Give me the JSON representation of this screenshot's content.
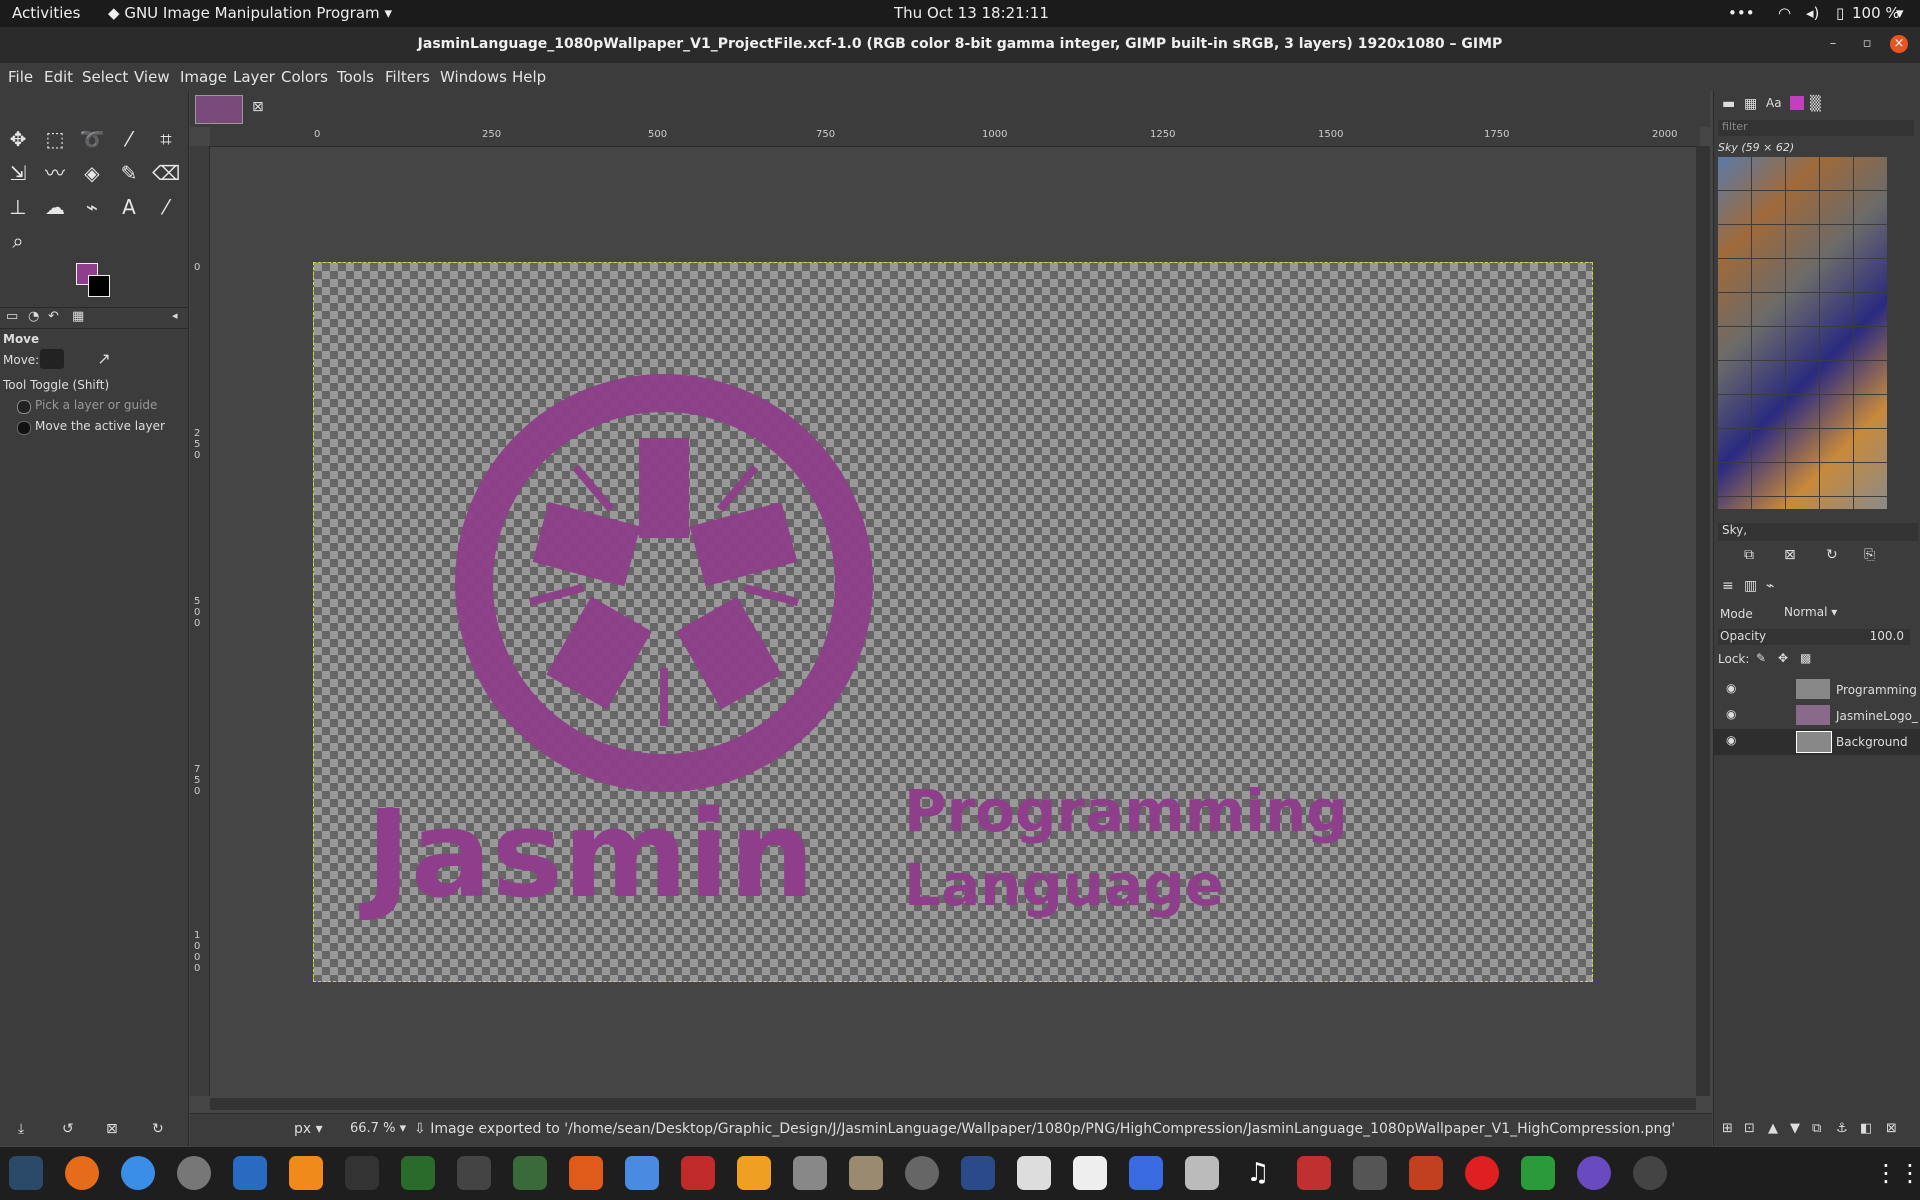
{
  "topbar": {
    "activities": "Activities",
    "app": "GNU Image Manipulation Program",
    "clock": "Thu Oct 13  18:21:11",
    "battery": "100 %"
  },
  "window": {
    "title": "JasminLanguage_1080pWallpaper_V1_ProjectFile.xcf-1.0 (RGB color 8-bit gamma integer, GIMP built-in sRGB, 3 layers) 1920x1080 – GIMP"
  },
  "menu": [
    "File",
    "Edit",
    "Select",
    "View",
    "Image",
    "Layer",
    "Colors",
    "Tools",
    "Filters",
    "Windows",
    "Help"
  ],
  "ruler_labels": [
    "0",
    "250",
    "500",
    "750",
    "1000",
    "1250",
    "1500",
    "1750",
    "2000"
  ],
  "vruler_labels": [
    "0",
    "250",
    "500",
    "750",
    "1000"
  ],
  "tool_options": {
    "title": "Move",
    "move_label": "Move:",
    "toggle": "Tool Toggle  (Shift)",
    "opt1": "Pick a layer or guide",
    "opt2": "Move the active layer"
  },
  "canvas": {
    "logo_word": "Jasmin",
    "line1": "Programming",
    "line2": "Language",
    "logo_color": "#8e3e8a"
  },
  "patterns": {
    "filter_placeholder": "filter",
    "selected": "Sky (59 × 62)",
    "name_field": "Sky,"
  },
  "layers": {
    "mode_label": "Mode",
    "mode_value": "Normal",
    "opacity_label": "Opacity",
    "opacity_value": "100.0",
    "lock_label": "Lock:",
    "items": [
      {
        "name": "Programming"
      },
      {
        "name": "JasmineLogo_"
      },
      {
        "name": "Background"
      }
    ]
  },
  "status": {
    "unit": "px",
    "zoom": "66.7 %",
    "message": "Image exported to '/home/sean/Desktop/Graphic_Design/J/JasminLanguage/Wallpaper/1080p/PNG/HighCompression/JasminLanguage_1080pWallpaper_V1_HighCompression.png'"
  },
  "colors": {
    "fg": "#8e3e8a",
    "bg": "#000000"
  },
  "taskbar_icons": [
    "system-monitor-icon",
    "firefox-icon",
    "help-icon",
    "settings-icon",
    "writer-icon",
    "vlc-icon",
    "terminal-icon",
    "vim-icon",
    "display-icon",
    "gimp-icon",
    "software-icon",
    "text-editor-icon",
    "graph-icon",
    "calculator-icon",
    "search-icon",
    "files-icon",
    "disk-icon",
    "inkscape-icon",
    "glasses-icon",
    "font-icon",
    "window-icon",
    "archive-icon",
    "music-icon",
    "pdf-icon",
    "gimp-active-icon",
    "mario-icon",
    "alert-icon",
    "spreadsheet-icon",
    "camera-icon",
    "updates-icon",
    "apps-grid-icon"
  ]
}
